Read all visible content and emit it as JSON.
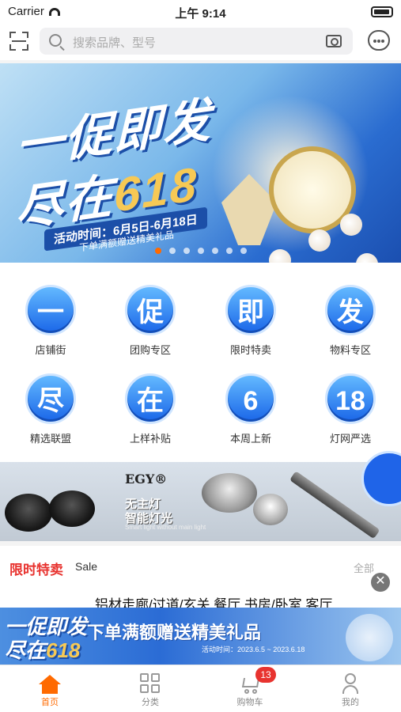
{
  "status": {
    "carrier": "Carrier",
    "time": "上午 9:14"
  },
  "search": {
    "placeholder": "搜索品牌、型号"
  },
  "banner": {
    "line1": "一促即发",
    "line2_prefix": "尽在",
    "line2_number": "618",
    "date": "活动时间：6月5日-6月18日",
    "gift": "下单满额赠送精美礼品",
    "active_slide": 1,
    "slide_count": 7
  },
  "nav": {
    "items": [
      {
        "glyph": "一",
        "label": "店铺街"
      },
      {
        "glyph": "促",
        "label": "团购专区"
      },
      {
        "glyph": "即",
        "label": "限时特卖"
      },
      {
        "glyph": "发",
        "label": "物料专区"
      },
      {
        "glyph": "尽",
        "label": "精选联盟"
      },
      {
        "glyph": "在",
        "label": "上样补贴"
      },
      {
        "glyph": "6",
        "label": "本周上新"
      },
      {
        "glyph": "18",
        "label": "灯网严选"
      }
    ]
  },
  "strip": {
    "logo": "EGY®",
    "slogan1": "无主灯",
    "slogan2": "智能灯光",
    "slogan3": "Smart light without main light"
  },
  "sale": {
    "title": "限时特卖",
    "subtitle": "Sale",
    "all": "全部",
    "close": "✕",
    "product": "铝材走廊/过道/玄关 餐厅 书房/卧室 客厅…",
    "banner_line1": "一促即发",
    "banner_line2_prefix": "尽在",
    "banner_line2_number": "618",
    "banner_slogan": "下单满额赠送精美礼品",
    "banner_date": "活动时间：2023.6.5 ~ 2023.6.18"
  },
  "tabbar": {
    "home": "首页",
    "category": "分类",
    "cart": "购物车",
    "cart_badge": "13",
    "mine": "我的"
  },
  "colors": {
    "accent": "#ff6a00",
    "sale_red": "#e8332f",
    "brand_blue": "#1a66e8"
  }
}
